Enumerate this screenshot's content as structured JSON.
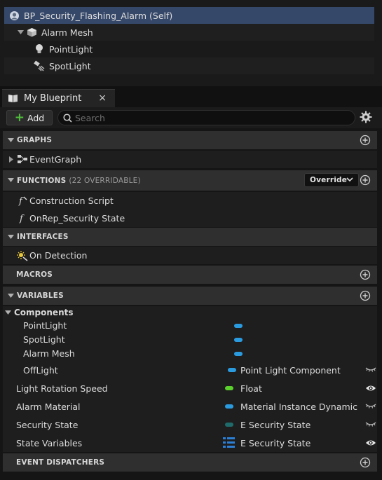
{
  "components_tree": {
    "root": "BP_Security_Flashing_Alarm (Self)",
    "items": [
      {
        "label": "Alarm Mesh",
        "icon": "cube-icon"
      },
      {
        "label": "PointLight",
        "icon": "light-bulb-icon"
      },
      {
        "label": "SpotLight",
        "icon": "spotlight-icon"
      }
    ]
  },
  "tab": {
    "label": "My Blueprint",
    "close": "×"
  },
  "toolbar": {
    "add_label": "Add",
    "search_placeholder": "Search"
  },
  "sections": {
    "graphs": {
      "title": "GRAPHS",
      "items": [
        "EventGraph"
      ]
    },
    "functions": {
      "title": "FUNCTIONS",
      "subtitle": "(22 OVERRIDABLE)",
      "override_label": "Override",
      "items": [
        "Construction Script",
        "OnRep_Security State"
      ]
    },
    "interfaces": {
      "title": "INTERFACES",
      "items": [
        "On Detection"
      ]
    },
    "macros": {
      "title": "MACROS"
    },
    "variables": {
      "title": "VARIABLES",
      "components_label": "Components",
      "components": [
        {
          "name": "PointLight",
          "color": "#2b9be0"
        },
        {
          "name": "SpotLight",
          "color": "#2b9be0"
        },
        {
          "name": "Alarm Mesh",
          "color": "#2b9be0"
        },
        {
          "name": "OffLight",
          "color": "#2b9be0",
          "type": "Point Light Component",
          "visibility": "hidden"
        }
      ],
      "vars": [
        {
          "name": "Light Rotation Speed",
          "type": "Float",
          "color": "#5ad12c",
          "visibility": "visible"
        },
        {
          "name": "Alarm Material",
          "type": "Material Instance Dynamic",
          "color": "#2b9be0",
          "visibility": "hidden"
        },
        {
          "name": "Security State",
          "type": "E Security State",
          "color": "#1f6b6b",
          "visibility": "hidden"
        },
        {
          "name": "State Variables",
          "type": "E Security State",
          "color": "#2b7fd6",
          "visibility": "visible",
          "container": "map"
        }
      ]
    },
    "event_dispatchers": {
      "title": "EVENT DISPATCHERS"
    }
  },
  "colors": {
    "selection": "#36486a",
    "section_bg": "#2f2f2f",
    "panel_bg": "#1e1e1e",
    "accent_green": "#4fbf3a"
  }
}
